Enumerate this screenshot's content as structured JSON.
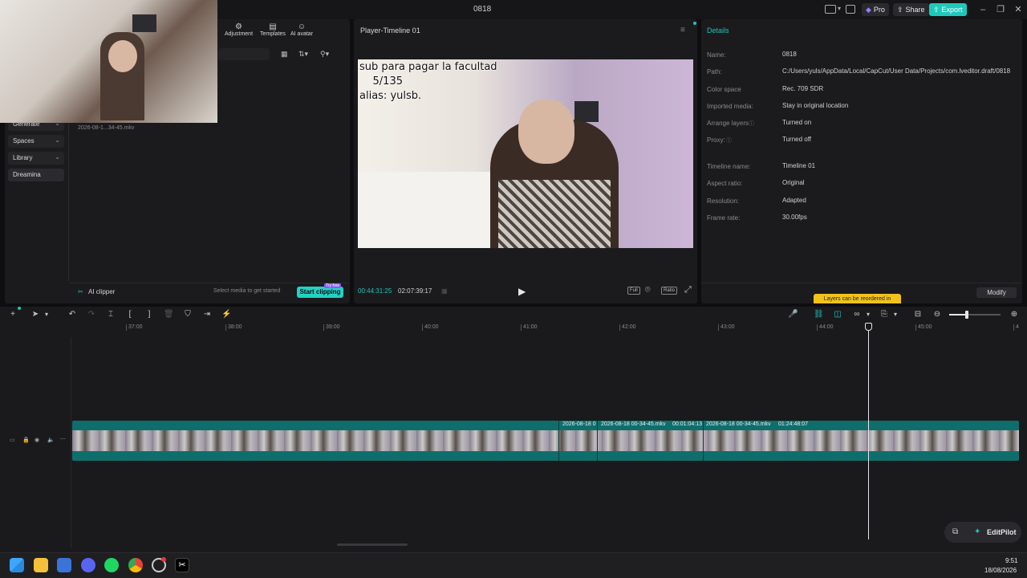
{
  "window": {
    "title": "0818"
  },
  "titlebar": {
    "pro_label": "Pro",
    "share_label": "Share",
    "export_label": "Export"
  },
  "toolbar_tabs": [
    {
      "label": "Adjustment",
      "icon": "sliders-icon"
    },
    {
      "label": "Templates",
      "icon": "templates-icon"
    },
    {
      "label": "AI avatar",
      "icon": "avatar-icon"
    }
  ],
  "sidebar": {
    "items": [
      {
        "label": "Generate"
      },
      {
        "label": "Spaces"
      },
      {
        "label": "Library"
      },
      {
        "label": "Dreamina"
      }
    ]
  },
  "media": {
    "file_name": "2026-08-1...34-45.mkv"
  },
  "ai_clipper": {
    "label": "AI clipper",
    "hint": "Select media to get started",
    "button": "Start clipping",
    "badge": "Try free"
  },
  "player": {
    "title": "Player-Timeline 01",
    "overlay_lines": [
      "sub para pagar la facultad",
      "    5/135",
      "alias: yulsb."
    ],
    "current_time": "00:44:31:25",
    "total_time": "02:07:39:17",
    "full_label": "Full",
    "ratio_label": "Ratio"
  },
  "details": {
    "title": "Details",
    "rows": [
      {
        "label": "Name:",
        "value": "0818"
      },
      {
        "label": "Path:",
        "value": "C:/Users/yuls/AppData/Local/CapCut/User Data/Projects/com.lveditor.draft/0818"
      },
      {
        "label": "Color space",
        "value": "Rec. 709 SDR"
      },
      {
        "label": "Imported media:",
        "value": "Stay in original location"
      },
      {
        "label": "Arrange layers",
        "value": "Turned on"
      },
      {
        "label": "Proxy:",
        "value": "Turned off"
      },
      {
        "label": "Timeline name:",
        "value": "Timeline 01"
      },
      {
        "label": "Aspect ratio:",
        "value": "Original"
      },
      {
        "label": "Resolution:",
        "value": "Adapted"
      },
      {
        "label": "Frame rate:",
        "value": "30.00fps"
      }
    ],
    "tooltip": "Layers can be reordered in",
    "modify_label": "Modify"
  },
  "timeline": {
    "ticks": [
      "37:00",
      "38:00",
      "39:00",
      "40:00",
      "41:00",
      "42:00",
      "43:00",
      "44:00",
      "45:00",
      "4"
    ],
    "clip_labels": [
      "2026-08-18 0",
      "2026-08-18 00-34-45.mkv",
      "00:01:04:13",
      "2026-08-18 00-34-45.mkv",
      "01:24:48:07"
    ],
    "editpilot_label": "EditPilot"
  },
  "taskbar": {
    "time": "9:51",
    "date": "18/08/2026"
  },
  "colors": {
    "accent": "#22c3b8",
    "export": "#1ec9bb",
    "clipper_button": "#22d3c5",
    "tooltip": "#f2c21b",
    "track": "#0f6e6c"
  }
}
